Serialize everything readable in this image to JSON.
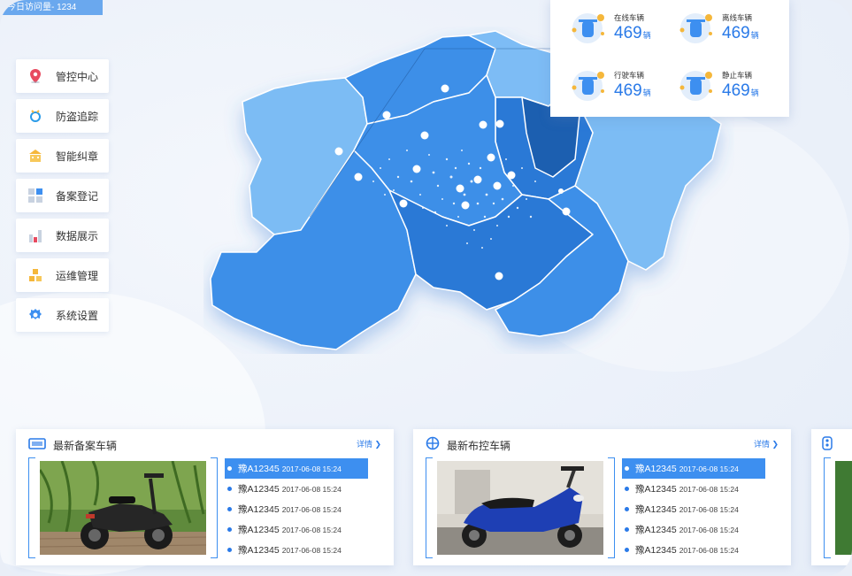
{
  "header": {
    "visit_label": "今日访问量- 1234"
  },
  "sidebar": {
    "items": [
      {
        "label": "管控中心",
        "icon": "location-pin-icon"
      },
      {
        "label": "防盗追踪",
        "icon": "tracker-icon"
      },
      {
        "label": "智能纠章",
        "icon": "building-icon"
      },
      {
        "label": "备案登记",
        "icon": "grid-icon"
      },
      {
        "label": "数据展示",
        "icon": "bar-chart-icon"
      },
      {
        "label": "运维管理",
        "icon": "blocks-icon"
      },
      {
        "label": "系统设置",
        "icon": "gear-icon"
      }
    ]
  },
  "stats": [
    {
      "label": "在线车辆",
      "value": "469",
      "unit": "辆"
    },
    {
      "label": "离线车辆",
      "value": "469",
      "unit": "辆"
    },
    {
      "label": "行驶车辆",
      "value": "469",
      "unit": "辆"
    },
    {
      "label": "静止车辆",
      "value": "469",
      "unit": "辆"
    }
  ],
  "cards": [
    {
      "title": "最新备案车辆",
      "more": "详情 ❯",
      "icon": "id-card-icon",
      "items": [
        {
          "plate": "豫A12345",
          "time": "2017-06-08 15:24"
        },
        {
          "plate": "豫A12345",
          "time": "2017-06-08 15:24"
        },
        {
          "plate": "豫A12345",
          "time": "2017-06-08 15:24"
        },
        {
          "plate": "豫A12345",
          "time": "2017-06-08 15:24"
        },
        {
          "plate": "豫A12345",
          "time": "2017-06-08 15:24"
        }
      ]
    },
    {
      "title": "最新布控车辆",
      "more": "详情 ❯",
      "icon": "crosshair-icon",
      "items": [
        {
          "plate": "豫A12345",
          "time": "2017-06-08 15:24"
        },
        {
          "plate": "豫A12345",
          "time": "2017-06-08 15:24"
        },
        {
          "plate": "豫A12345",
          "time": "2017-06-08 15:24"
        },
        {
          "plate": "豫A12345",
          "time": "2017-06-08 15:24"
        },
        {
          "plate": "豫A12345",
          "time": "2017-06-08 15:24"
        }
      ]
    }
  ],
  "colors": {
    "accent": "#2a7ae8",
    "map_light": "#7dbcf5",
    "map_mid": "#3d8fe8",
    "map_dark": "#1f5fb0"
  }
}
